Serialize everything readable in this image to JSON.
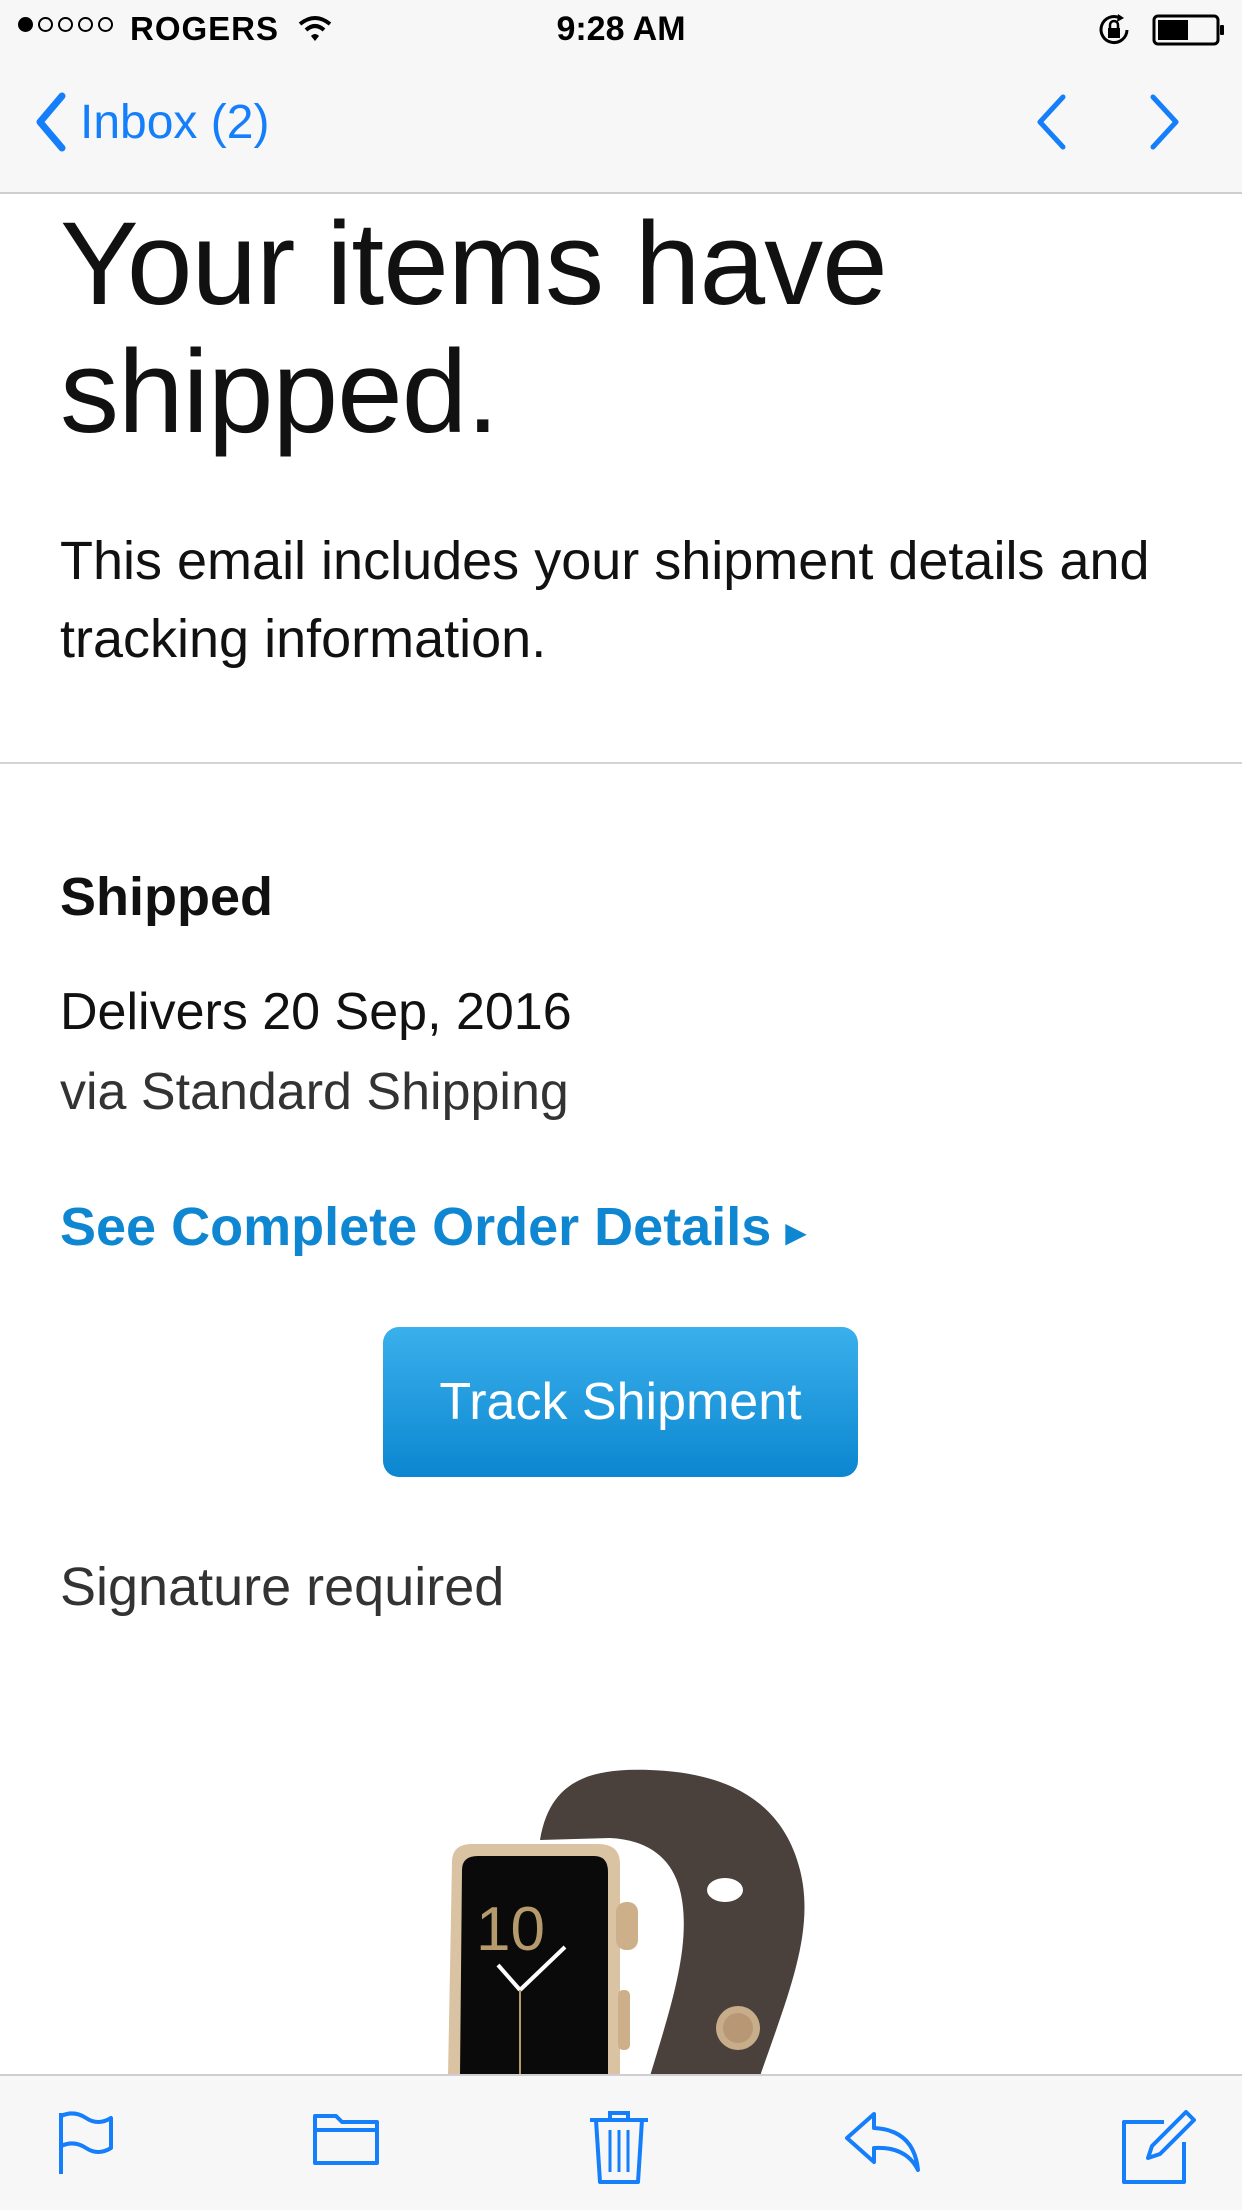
{
  "status_bar": {
    "carrier": "ROGERS",
    "time": "9:28 AM",
    "signal_bars_filled": 1,
    "signal_bars_total": 5
  },
  "nav": {
    "back_label": "Inbox (2)"
  },
  "email": {
    "headline": "Your items have shipped.",
    "intro": "This email includes your shipment details and tracking information.",
    "status_title": "Shipped",
    "delivers": "Delivers 20 Sep, 2016",
    "via": "via Standard Shipping",
    "order_link": "See Complete Order Details",
    "track_button": "Track Shipment",
    "signature": "Signature required"
  },
  "toolbar": {
    "icons": [
      "flag-icon",
      "folder-icon",
      "trash-icon",
      "reply-icon",
      "compose-icon"
    ]
  },
  "colors": {
    "ios_blue": "#147efb",
    "link_blue": "#0e86d1",
    "button_top": "#3ab0ec",
    "button_bottom": "#0b86d0",
    "bar_bg": "#f7f7f7"
  }
}
